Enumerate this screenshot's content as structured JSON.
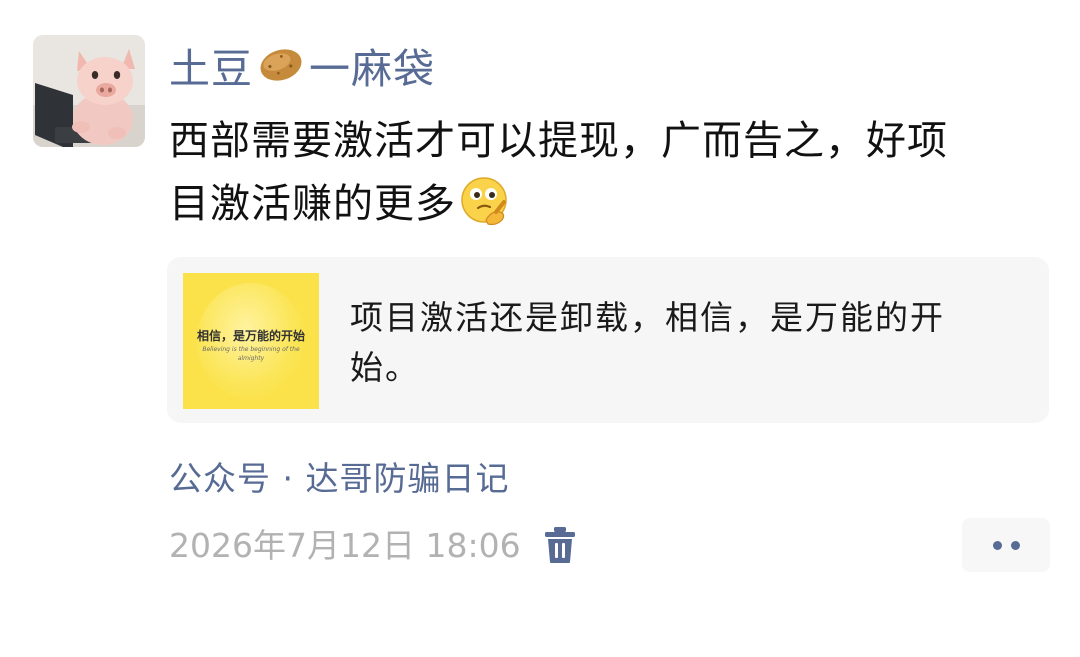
{
  "post": {
    "author": {
      "name_part1": "土豆",
      "name_emoji": "potato-emoji",
      "name_part2": "一麻袋",
      "avatar_icon": "pig-avatar"
    },
    "text_line1": "西部需要激活才可以提现，广而告之，好项",
    "text_line2": "目激活赚的更多",
    "trailing_emoji": "thinking-face-emoji",
    "link_card": {
      "thumbnail_text_cn": "相信，是万能的开始",
      "thumbnail_text_en": "Believing is the beginning of the almighty",
      "title": "项目激活还是卸载，相信，是万能的开始。"
    },
    "source": "公众号 · 达哥防骗日记",
    "timestamp": "2026年7月12日 18:06",
    "delete_icon": "trash-icon",
    "more_icon": "more-dots-icon"
  },
  "colors": {
    "link_blue": "#576b95",
    "text": "#111111",
    "timestamp_gray": "#b2b2b2",
    "card_bg": "#f6f6f6",
    "thumbnail_yellow": "#fbe24a"
  }
}
